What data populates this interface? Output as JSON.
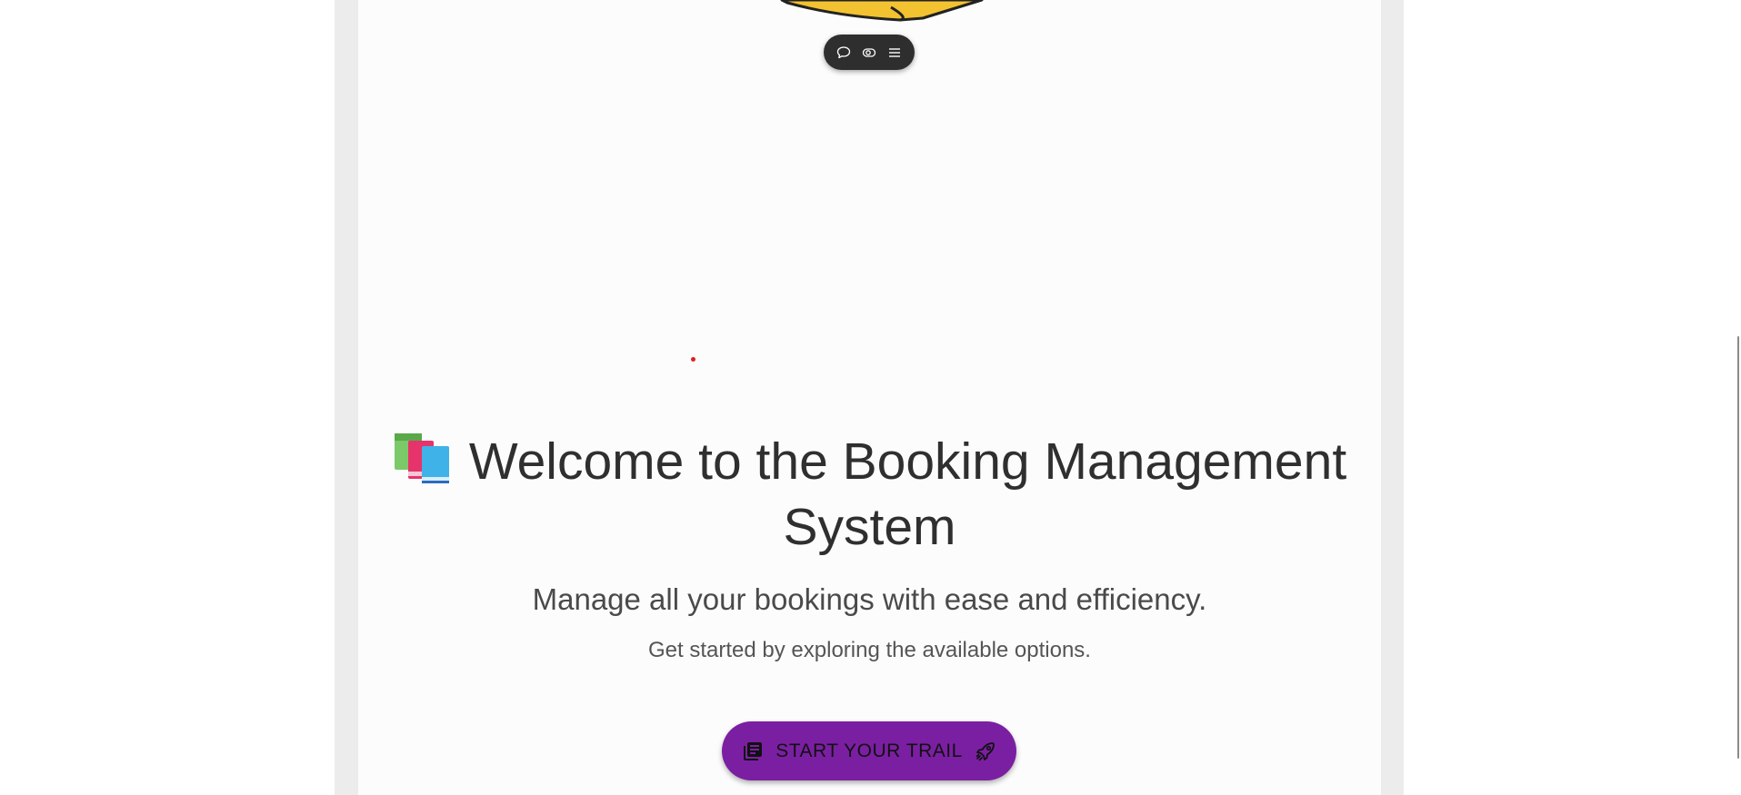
{
  "toolbar": {
    "buttons": [
      {
        "icon": "comment-icon"
      },
      {
        "icon": "toggle-view-icon"
      },
      {
        "icon": "menu-icon"
      }
    ]
  },
  "hero": {
    "emoji_icon": "books-icon",
    "title": "Welcome to the Booking Management System",
    "subtitle": "Manage all your bookings with ease and efficiency.",
    "caption": "Get started by exploring the available options."
  },
  "cta": {
    "label": "START YOUR TRAIL",
    "leading_icon": "library-books-icon",
    "trailing_icon": "rocket-icon"
  },
  "colors": {
    "cta_background": "#7b1fa2",
    "toolbar_background": "#2e2e2e",
    "card_background": "#fcfcfc",
    "outer_column": "#ececec",
    "illustration_yellow": "#f2c230"
  }
}
